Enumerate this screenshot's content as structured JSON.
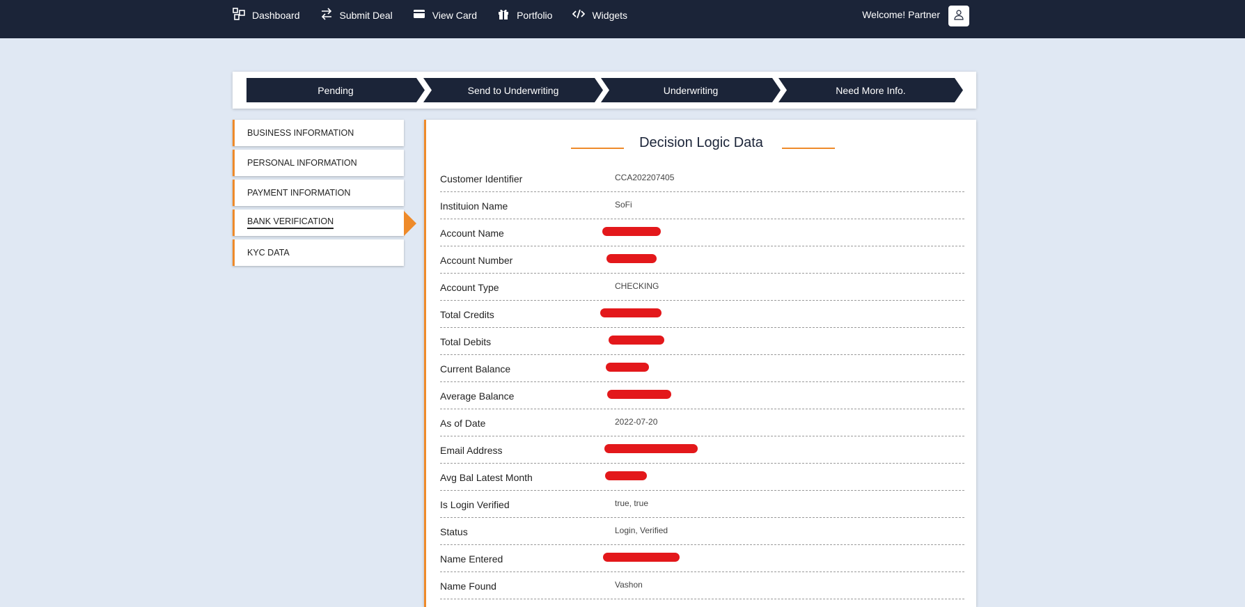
{
  "nav": {
    "items": [
      {
        "label": "Dashboard",
        "icon": "dashboard-icon"
      },
      {
        "label": "Submit Deal",
        "icon": "transfer-icon"
      },
      {
        "label": "View Card",
        "icon": "credit-card-icon"
      },
      {
        "label": "Portfolio",
        "icon": "gift-icon"
      },
      {
        "label": "Widgets",
        "icon": "code-icon"
      }
    ],
    "welcome": "Welcome! Partner",
    "avatar_icon": "user-icon"
  },
  "steps": [
    "Pending",
    "Send to Underwriting",
    "Underwriting",
    "Need More Info."
  ],
  "sidebar": {
    "items": [
      {
        "label": "BUSINESS INFORMATION"
      },
      {
        "label": "PERSONAL INFORMATION"
      },
      {
        "label": "PAYMENT INFORMATION"
      },
      {
        "label": "BANK VERIFICATION"
      },
      {
        "label": "KYC DATA"
      }
    ],
    "active": "BANK VERIFICATION"
  },
  "panel": {
    "title": "Decision Logic Data",
    "rows": [
      {
        "label": "Customer Identifier",
        "value": "CCA202207405"
      },
      {
        "label": "Instituion Name",
        "value": "SoFi"
      },
      {
        "label": "Account Name",
        "value": "",
        "redacted": true
      },
      {
        "label": "Account Number",
        "value": "",
        "redacted": true
      },
      {
        "label": "Account Type",
        "value": "CHECKING"
      },
      {
        "label": "Total Credits",
        "value": "",
        "redacted": true
      },
      {
        "label": "Total Debits",
        "value": "",
        "redacted": true
      },
      {
        "label": "Current Balance",
        "value": "",
        "redacted": true
      },
      {
        "label": "Average Balance",
        "value": "",
        "redacted": true
      },
      {
        "label": "As of Date",
        "value": "2022-07-20"
      },
      {
        "label": "Email Address",
        "value": "",
        "redacted": true
      },
      {
        "label": "Avg Bal Latest Month",
        "value": "",
        "redacted": true
      },
      {
        "label": "Is Login Verified",
        "value": "true, true"
      },
      {
        "label": "Status",
        "value": "Login, Verified"
      },
      {
        "label": "Name Entered",
        "value": "",
        "redacted": true
      },
      {
        "label": "Name Found",
        "value": "Vashon"
      }
    ]
  },
  "colors": {
    "navy": "#1b2438",
    "accent": "#ee8a2a",
    "redaction": "#e3181b",
    "background": "#e0e8f3"
  }
}
